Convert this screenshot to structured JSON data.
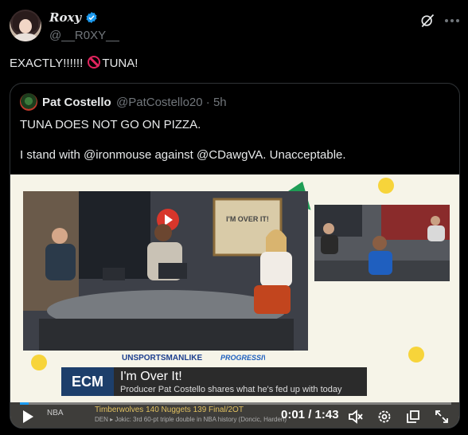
{
  "author": {
    "display_name": "Roxy",
    "handle": "@__R0XY__"
  },
  "tweet": {
    "text_before": "EXACTLY!!!!!! ",
    "text_after": "TUNA!"
  },
  "quoted": {
    "name": "Pat Costello",
    "handle_time": "@PatCostello20 · 5h",
    "line1": "TUNA DOES NOT GO ON PIZZA.",
    "line2": "I stand with @ironmouse against @CDawgVA. Unacceptable."
  },
  "video": {
    "show_logo": "UNSPORTSMANLIKE",
    "show_logo_2": "PROGRESSIVE",
    "lower_third_logo": "ECM",
    "lower_third_title": "I'm Over It!",
    "lower_third_sub": "Producer Pat Costello shares what he's fed up with today",
    "studio_sign": "I'M OVER IT!",
    "ticker_league": "NBA",
    "ticker_game": "Timberwolves 140  Nuggets  139  Final/2OT",
    "ticker_note": "DEN  ▸ Jokic: 3rd 60-pt triple double in NBA history (Doncic, Harden)",
    "time": "0:01 / 1:43",
    "progress": 0.01
  },
  "colors": {
    "accent": "#1d9bf0",
    "verified": "#1d9bf0",
    "no_symbol": "#e0245e",
    "dot_yellow": "#f7d43a"
  },
  "icons": [
    "verified-icon",
    "grok-icon",
    "more-icon",
    "no-entry-icon",
    "play-icon",
    "mute-icon",
    "settings-icon",
    "pip-icon",
    "fullscreen-icon"
  ]
}
